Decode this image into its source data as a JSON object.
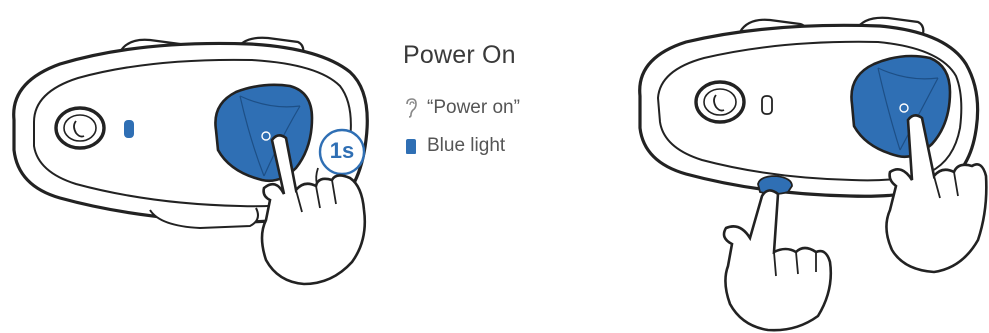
{
  "section": {
    "title": "Power On"
  },
  "indicators": [
    {
      "icon": "ear-icon",
      "text": "“Power on”"
    },
    {
      "icon": "blue-light-icon",
      "text": "Blue light"
    }
  ],
  "press_duration_label": "1s",
  "colors": {
    "accent": "#2f6fb4",
    "outline": "#222222",
    "text": "#555555"
  }
}
